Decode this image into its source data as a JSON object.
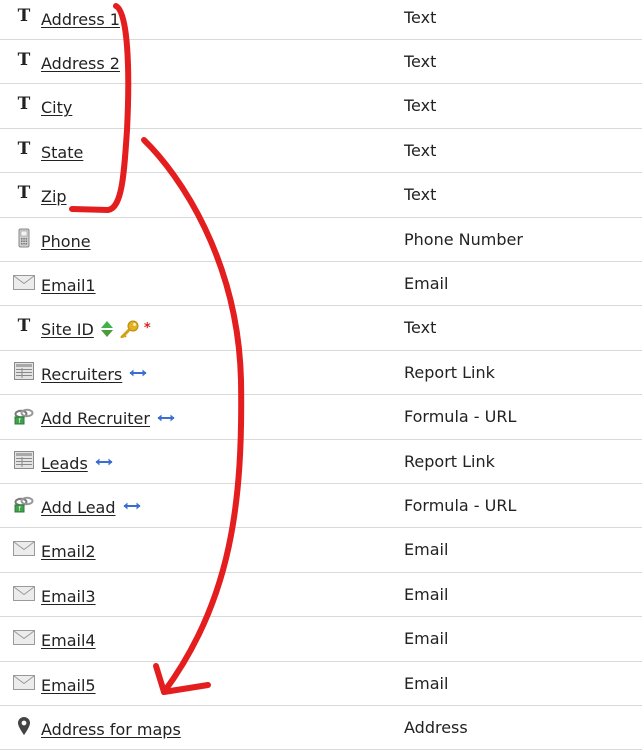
{
  "fields": [
    {
      "name": "Address 1",
      "type": "Text",
      "icon": "text-icon"
    },
    {
      "name": "Address 2",
      "type": "Text",
      "icon": "text-icon"
    },
    {
      "name": "City",
      "type": "Text",
      "icon": "text-icon"
    },
    {
      "name": "State",
      "type": "Text",
      "icon": "text-icon"
    },
    {
      "name": "Zip",
      "type": "Text",
      "icon": "text-icon"
    },
    {
      "name": "Phone",
      "type": "Phone Number",
      "icon": "phone-icon"
    },
    {
      "name": "Email1",
      "type": "Email",
      "icon": "email-icon"
    },
    {
      "name": "Site ID",
      "type": "Text",
      "icon": "text-icon",
      "badges": [
        "sort-arrows-icon",
        "key-icon",
        "required-asterisk"
      ],
      "required_mark": "*"
    },
    {
      "name": "Recruiters",
      "type": "Report Link",
      "icon": "report-link-icon",
      "badges": [
        "relationship-arrow-icon"
      ]
    },
    {
      "name": "Add Recruiter",
      "type": "Formula - URL",
      "icon": "formula-url-icon",
      "badges": [
        "relationship-arrow-icon"
      ]
    },
    {
      "name": "Leads",
      "type": "Report Link",
      "icon": "report-link-icon",
      "badges": [
        "relationship-arrow-icon"
      ]
    },
    {
      "name": "Add Lead",
      "type": "Formula - URL",
      "icon": "formula-url-icon",
      "badges": [
        "relationship-arrow-icon"
      ]
    },
    {
      "name": "Email2",
      "type": "Email",
      "icon": "email-icon"
    },
    {
      "name": "Email3",
      "type": "Email",
      "icon": "email-icon"
    },
    {
      "name": "Email4",
      "type": "Email",
      "icon": "email-icon"
    },
    {
      "name": "Email5",
      "type": "Email",
      "icon": "email-icon"
    },
    {
      "name": "Address for maps",
      "type": "Address",
      "icon": "map-pin-icon"
    }
  ],
  "colors": {
    "annotation": "#e41e1e",
    "divider": "#d9d9d9",
    "relationship_arrow": "#3a6fd1",
    "key": "#e5b21f",
    "sort_up": "#3fb24b",
    "required": "#e02020"
  }
}
